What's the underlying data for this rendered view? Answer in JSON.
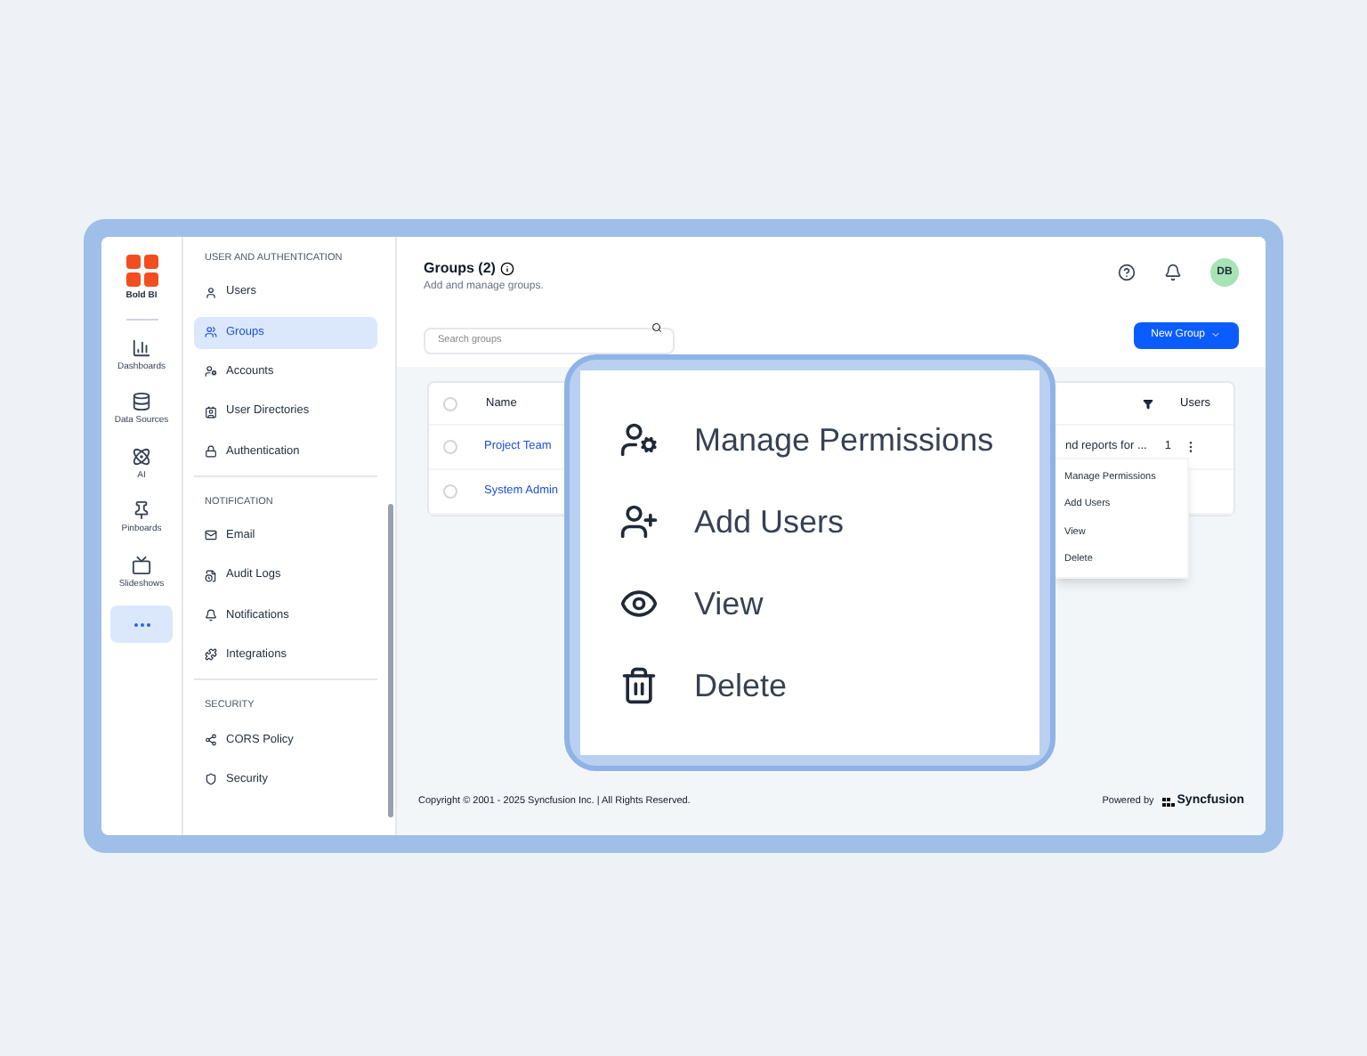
{
  "rail": {
    "brand": "Bold BI",
    "items": [
      {
        "label": "Dashboards",
        "kind": "chart",
        "selected": false
      },
      {
        "label": "Data Sources",
        "kind": "data",
        "selected": false
      },
      {
        "label": "AI",
        "kind": "ai",
        "selected": false
      },
      {
        "label": "Pinboards",
        "kind": "pin",
        "selected": false
      },
      {
        "label": "Slideshows",
        "kind": "tv",
        "selected": false
      }
    ],
    "more": {
      "selected": true
    }
  },
  "nav": {
    "sections": [
      {
        "title": "USER AND AUTHENTICATION",
        "items": [
          {
            "label": "Users",
            "kind": "user",
            "selected": false
          },
          {
            "label": "Groups",
            "kind": "group",
            "selected": true
          },
          {
            "label": "Accounts",
            "kind": "accounts",
            "selected": false
          },
          {
            "label": "User Directories",
            "kind": "directory",
            "selected": false
          },
          {
            "label": "Authentication",
            "kind": "lock",
            "selected": false
          }
        ]
      },
      {
        "title": "NOTIFICATION",
        "items": [
          {
            "label": "Email",
            "kind": "mail",
            "selected": false
          },
          {
            "label": "Audit Logs",
            "kind": "log",
            "selected": false
          },
          {
            "label": "Notifications",
            "kind": "bell",
            "selected": false
          },
          {
            "label": "Integrations",
            "kind": "puzzle",
            "selected": false
          }
        ]
      },
      {
        "title": "SECURITY",
        "items": [
          {
            "label": "CORS Policy",
            "kind": "cors",
            "selected": false
          },
          {
            "label": "Security",
            "kind": "shield",
            "selected": false
          }
        ]
      }
    ]
  },
  "header": {
    "title": "Groups (2)",
    "subtitle": "Add and manage groups.",
    "avatar": "DB"
  },
  "search": {
    "placeholder": "Search groups"
  },
  "new_group_button": "New Group",
  "table": {
    "select_all": {
      "checked": false
    },
    "columns": [
      "Name",
      "Users"
    ],
    "rows": [
      {
        "checked": false,
        "name": "Project Team",
        "description": "nd reports for ...",
        "users": "1"
      },
      {
        "checked": false,
        "name": "System Admin"
      }
    ]
  },
  "action_menu": [
    "Manage Permissions",
    "Add Users",
    "View",
    "Delete"
  ],
  "callout": {
    "items": [
      {
        "label": "Manage Permissions",
        "kind": "permissions"
      },
      {
        "label": "Add Users",
        "kind": "add"
      },
      {
        "label": "View",
        "kind": "view"
      },
      {
        "label": "Delete",
        "kind": "delete"
      }
    ]
  },
  "footer": {
    "copyright": "Copyright © 2001 - 2025 Syncfusion Inc. | All Rights Reserved.",
    "powered_by": "Powered by",
    "logo": "Syncfusion"
  }
}
